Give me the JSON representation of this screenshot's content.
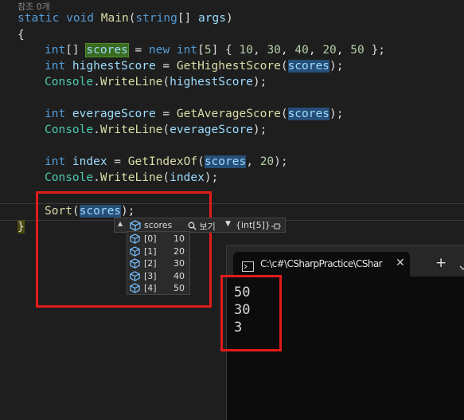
{
  "editor": {
    "codelens": "참조 0개",
    "lines": [
      {
        "parts": [
          [
            "kw",
            "static "
          ],
          [
            "kw",
            "void "
          ],
          [
            "fn",
            "Main"
          ],
          [
            "plain",
            "("
          ],
          [
            "kw",
            "string"
          ],
          [
            "plain",
            "[] "
          ],
          [
            "var",
            "args"
          ],
          [
            "plain",
            ")"
          ]
        ]
      },
      {
        "parts": [
          [
            "plain",
            "{"
          ]
        ]
      },
      {
        "parts": [
          [
            "kw",
            "int"
          ],
          [
            "plain",
            "[] "
          ],
          [
            "hlg",
            "scores"
          ],
          [
            "plain",
            " = "
          ],
          [
            "kw",
            "new "
          ],
          [
            "kw",
            "int"
          ],
          [
            "plain",
            "["
          ],
          [
            "num",
            "5"
          ],
          [
            "plain",
            "] { "
          ],
          [
            "num",
            "10"
          ],
          [
            "plain",
            ", "
          ],
          [
            "num",
            "30"
          ],
          [
            "plain",
            ", "
          ],
          [
            "num",
            "40"
          ],
          [
            "plain",
            ", "
          ],
          [
            "num",
            "20"
          ],
          [
            "plain",
            ", "
          ],
          [
            "num",
            "50"
          ],
          [
            "plain",
            " };"
          ]
        ]
      },
      {
        "parts": [
          [
            "kw",
            "int "
          ],
          [
            "var",
            "highestScore"
          ],
          [
            "plain",
            " = "
          ],
          [
            "fn",
            "GetHighestScore"
          ],
          [
            "plain",
            "("
          ],
          [
            "hlb",
            "scores"
          ],
          [
            "plain",
            ");"
          ]
        ]
      },
      {
        "parts": [
          [
            "ty",
            "Console"
          ],
          [
            "plain",
            "."
          ],
          [
            "fn",
            "WriteLine"
          ],
          [
            "plain",
            "("
          ],
          [
            "var",
            "highestScore"
          ],
          [
            "plain",
            ");"
          ]
        ]
      },
      {
        "parts": [
          [
            "kw",
            "int "
          ],
          [
            "var",
            "everageScore"
          ],
          [
            "plain",
            " = "
          ],
          [
            "fn",
            "GetAverageScore"
          ],
          [
            "plain",
            "("
          ],
          [
            "hlb",
            "scores"
          ],
          [
            "plain",
            ");"
          ]
        ]
      },
      {
        "parts": [
          [
            "ty",
            "Console"
          ],
          [
            "plain",
            "."
          ],
          [
            "fn",
            "WriteLine"
          ],
          [
            "plain",
            "("
          ],
          [
            "var",
            "everageScore"
          ],
          [
            "plain",
            ");"
          ]
        ]
      },
      {
        "parts": [
          [
            "kw",
            "int "
          ],
          [
            "var",
            "index"
          ],
          [
            "plain",
            " = "
          ],
          [
            "fn",
            "GetIndexOf"
          ],
          [
            "plain",
            "("
          ],
          [
            "hlb",
            "scores"
          ],
          [
            "plain",
            ", "
          ],
          [
            "num",
            "20"
          ],
          [
            "plain",
            ");"
          ]
        ]
      },
      {
        "parts": [
          [
            "ty",
            "Console"
          ],
          [
            "plain",
            "."
          ],
          [
            "fn",
            "WriteLine"
          ],
          [
            "plain",
            "("
          ],
          [
            "var",
            "index"
          ],
          [
            "plain",
            ");"
          ]
        ]
      },
      {
        "parts": [
          [
            "fn",
            "Sort"
          ],
          [
            "plain",
            "("
          ],
          [
            "hlb",
            "scores"
          ],
          [
            "plain",
            ");"
          ]
        ]
      },
      {
        "parts": [
          [
            "plain",
            "}"
          ]
        ]
      }
    ]
  },
  "datatip": {
    "name": "scores",
    "view_label": "보기",
    "value": "{int[5]}",
    "items": [
      {
        "index": "[0]",
        "value": "10"
      },
      {
        "index": "[1]",
        "value": "20"
      },
      {
        "index": "[2]",
        "value": "30"
      },
      {
        "index": "[3]",
        "value": "40"
      },
      {
        "index": "[4]",
        "value": "50"
      }
    ]
  },
  "console": {
    "tab_title": "C:\\c#\\CSharpPractice\\CShar",
    "close_glyph": "✕",
    "newtab_glyph": "+",
    "output": [
      "50",
      "30",
      "3"
    ]
  },
  "colors": {
    "highlight_box": "#e11b1b",
    "background": "#1e1e1e",
    "console_bg": "#0c0c0c"
  }
}
